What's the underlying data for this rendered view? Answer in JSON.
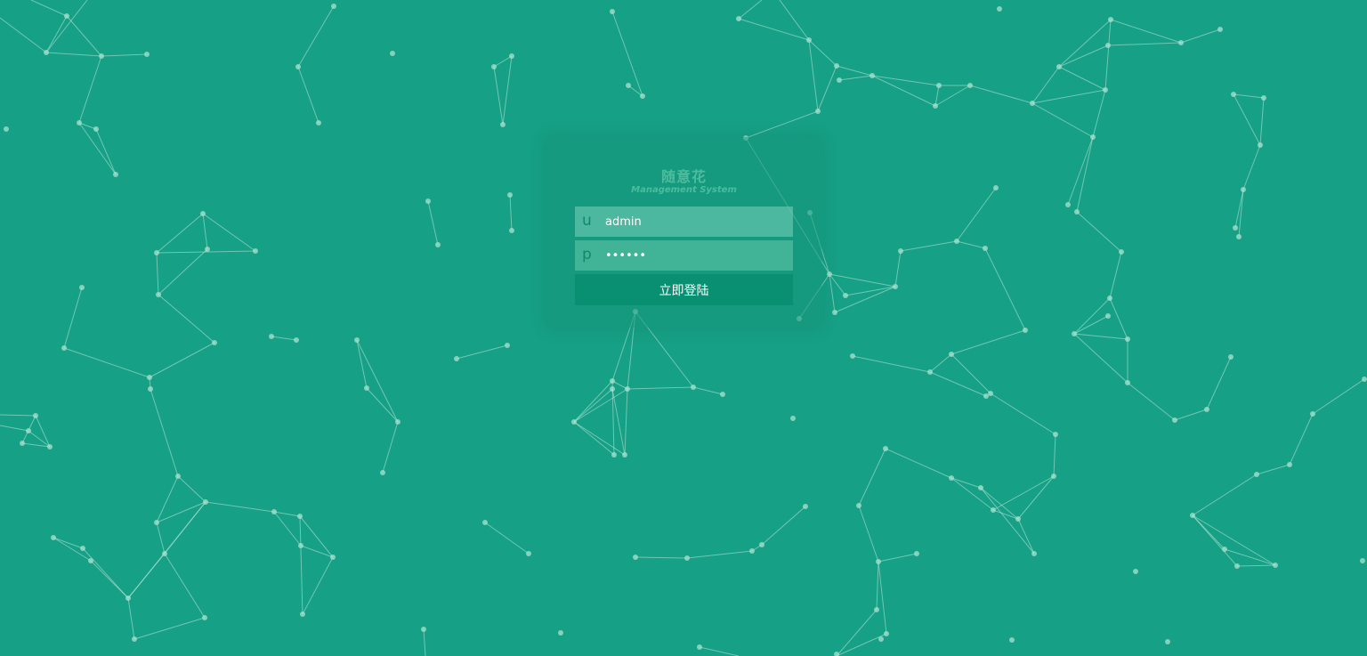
{
  "theme": {
    "background": "#16a085",
    "button": "#098f71",
    "accent": "#4dbc9e"
  },
  "login": {
    "title": "随意花",
    "subtitle": "Management System",
    "username": {
      "prefix": "u",
      "value": "admin"
    },
    "password": {
      "prefix": "p",
      "value": "••••••"
    },
    "submit_label": "立即登陆"
  }
}
